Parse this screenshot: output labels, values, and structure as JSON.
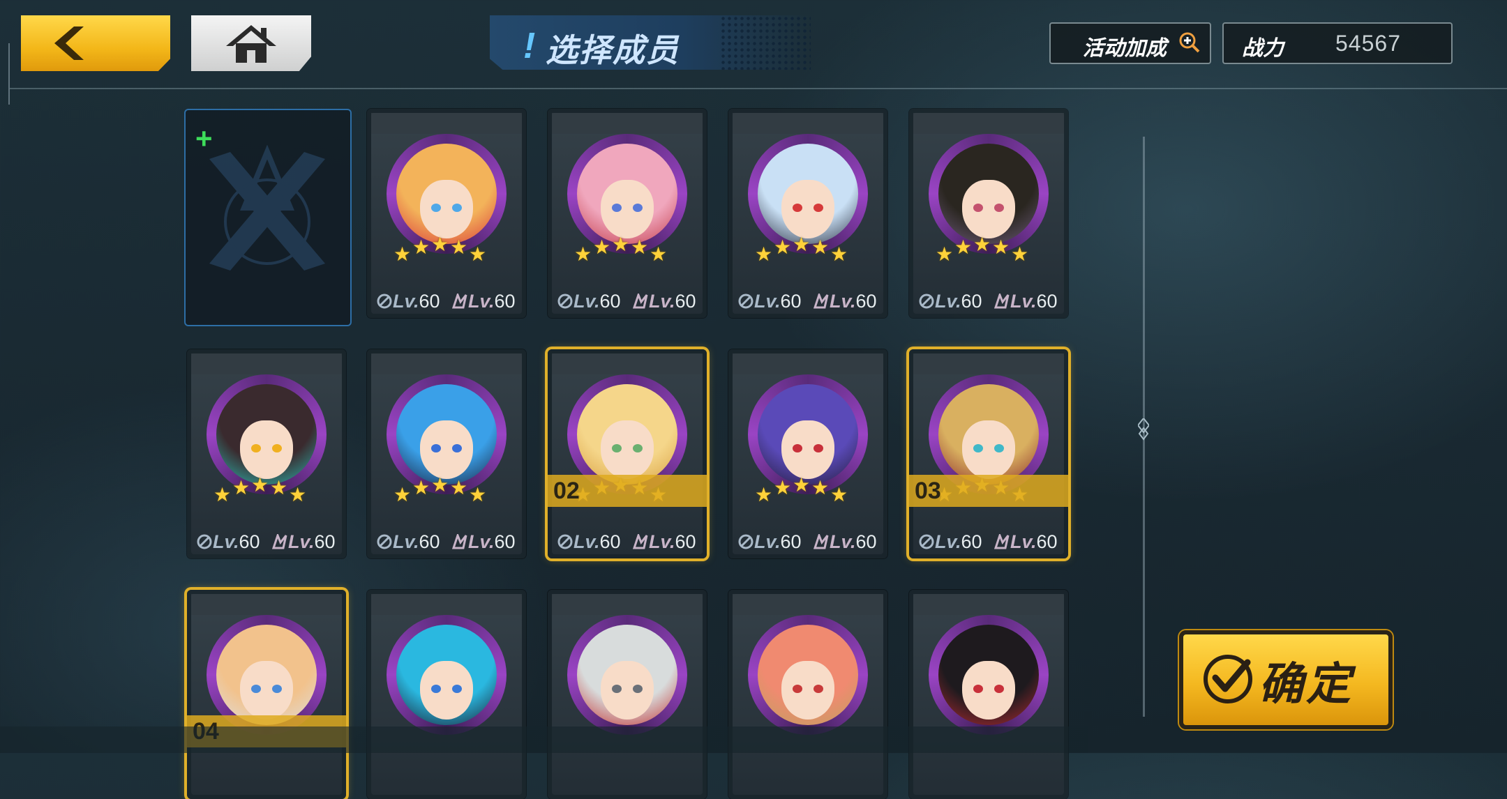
{
  "header": {
    "title_mark": "!",
    "title": "选择成员",
    "bonus_label": "活动加成",
    "power_label": "战力",
    "power_value": "54567"
  },
  "icons": {
    "back": "chevron-left-icon",
    "home": "home-icon",
    "bonus": "magnifier-plus-icon",
    "empty_slot": "plus-icon",
    "confirm": "checkmark-icon"
  },
  "colors": {
    "accent_gold": "#f3b719",
    "selection_gold": "#e0b02a",
    "portrait_ring": "#9a44c4",
    "empty_border": "#2d6ea6",
    "plus_green": "#3ddc5a"
  },
  "empty_slot": {
    "symbol": "+"
  },
  "level_prefix": "Lv.",
  "members": [
    {
      "weapon_lv": "60",
      "skill_lv": "60",
      "stars": 5,
      "order": "",
      "hair": "#f3b35a",
      "accent": "#d93a3a",
      "eye": "#4fa8e8"
    },
    {
      "weapon_lv": "60",
      "skill_lv": "60",
      "stars": 5,
      "order": "",
      "hair": "#f0a7bd",
      "accent": "#c23b4a",
      "eye": "#5a7ad8"
    },
    {
      "weapon_lv": "60",
      "skill_lv": "60",
      "stars": 5,
      "order": "",
      "hair": "#c9e0f5",
      "accent": "#2a3040",
      "eye": "#d63a3a"
    },
    {
      "weapon_lv": "60",
      "skill_lv": "60",
      "stars": 5,
      "order": "",
      "hair": "#2a2620",
      "accent": "#6b5a78",
      "eye": "#c4526e"
    },
    {
      "weapon_lv": "60",
      "skill_lv": "60",
      "stars": 5,
      "order": "",
      "hair": "#3a2a2e",
      "accent": "#2ab8b0",
      "eye": "#f0b020"
    },
    {
      "weapon_lv": "60",
      "skill_lv": "60",
      "stars": 5,
      "order": "",
      "hair": "#3aa0e8",
      "accent": "#1a2440",
      "eye": "#3a70d8"
    },
    {
      "weapon_lv": "60",
      "skill_lv": "60",
      "stars": 5,
      "order": "02",
      "hair": "#f5d68a",
      "accent": "#d8a040",
      "eye": "#6ab070"
    },
    {
      "weapon_lv": "60",
      "skill_lv": "60",
      "stars": 5,
      "order": "",
      "hair": "#5a4ab8",
      "accent": "#241c3a",
      "eye": "#c8303a"
    },
    {
      "weapon_lv": "60",
      "skill_lv": "60",
      "stars": 5,
      "order": "03",
      "hair": "#d9b060",
      "accent": "#8a2a2a",
      "eye": "#40b8c8"
    },
    {
      "weapon_lv": "",
      "skill_lv": "",
      "stars": 0,
      "order": "04",
      "hair": "#f2c28c",
      "accent": "#dddddd",
      "eye": "#4a8ad8"
    },
    {
      "weapon_lv": "",
      "skill_lv": "",
      "stars": 0,
      "order": "",
      "hair": "#2ab8e0",
      "accent": "#1a2030",
      "eye": "#3a7ad8"
    },
    {
      "weapon_lv": "",
      "skill_lv": "",
      "stars": 0,
      "order": "",
      "hair": "#d8dcdc",
      "accent": "#c23030",
      "eye": "#6a7078"
    },
    {
      "weapon_lv": "",
      "skill_lv": "",
      "stars": 0,
      "order": "",
      "hair": "#f08a70",
      "accent": "#c0a060",
      "eye": "#c83a3a"
    },
    {
      "weapon_lv": "",
      "skill_lv": "",
      "stars": 0,
      "order": "",
      "hair": "#1e1a1e",
      "accent": "#b02a30",
      "eye": "#c8303a"
    }
  ],
  "confirm_label": "确定"
}
